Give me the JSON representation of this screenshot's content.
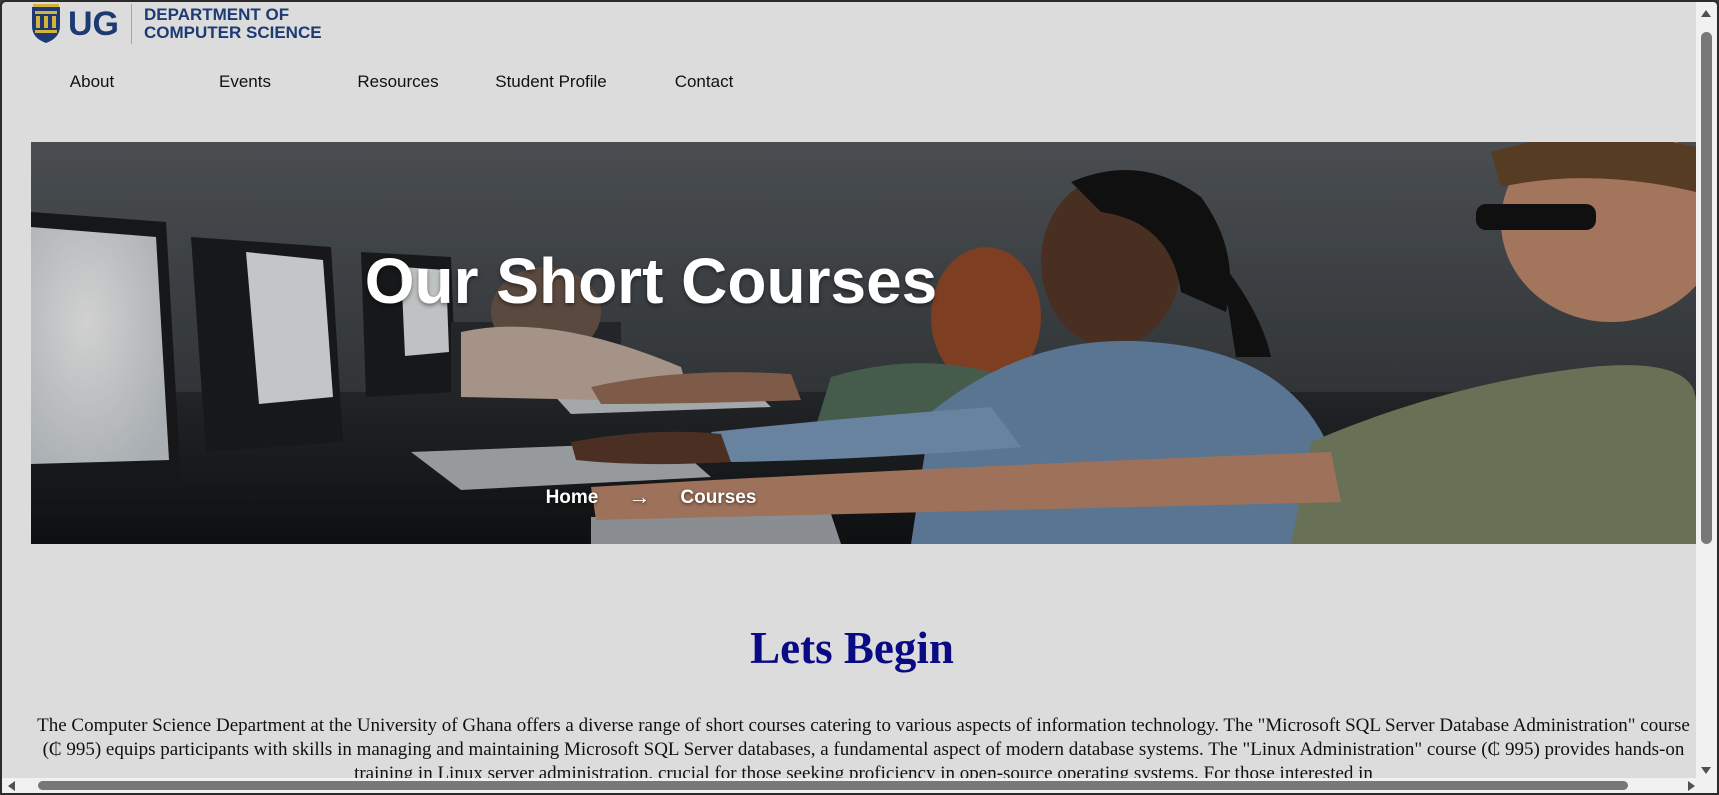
{
  "header": {
    "logo_short": "UG",
    "logo_line1": "DEPARTMENT OF",
    "logo_line2": "COMPUTER SCIENCE"
  },
  "nav": {
    "items": [
      {
        "label": "About"
      },
      {
        "label": "Events"
      },
      {
        "label": "Resources"
      },
      {
        "label": "Student Profile"
      },
      {
        "label": "Contact"
      }
    ]
  },
  "hero": {
    "title": "Our Short Courses",
    "breadcrumb_home": "Home",
    "breadcrumb_arrow": "→",
    "breadcrumb_current": "Courses"
  },
  "content": {
    "heading": "Lets Begin",
    "intro": "The Computer Science Department at the University of Ghana offers a diverse range of short courses catering to various aspects of information technology. The \"Microsoft SQL Server Database Administration\" course (₵ 995) equips participants with skills in managing and maintaining Microsoft SQL Server databases, a fundamental aspect of modern database systems. The \"Linux Administration\" course (₵ 995) provides hands-on training in Linux server administration, crucial for those seeking proficiency in open-source operating systems. For those interested in"
  },
  "colors": {
    "page_bg": "#dcdcdc",
    "brand_blue": "#1d3b72",
    "heading_navy": "#0a0a84"
  }
}
